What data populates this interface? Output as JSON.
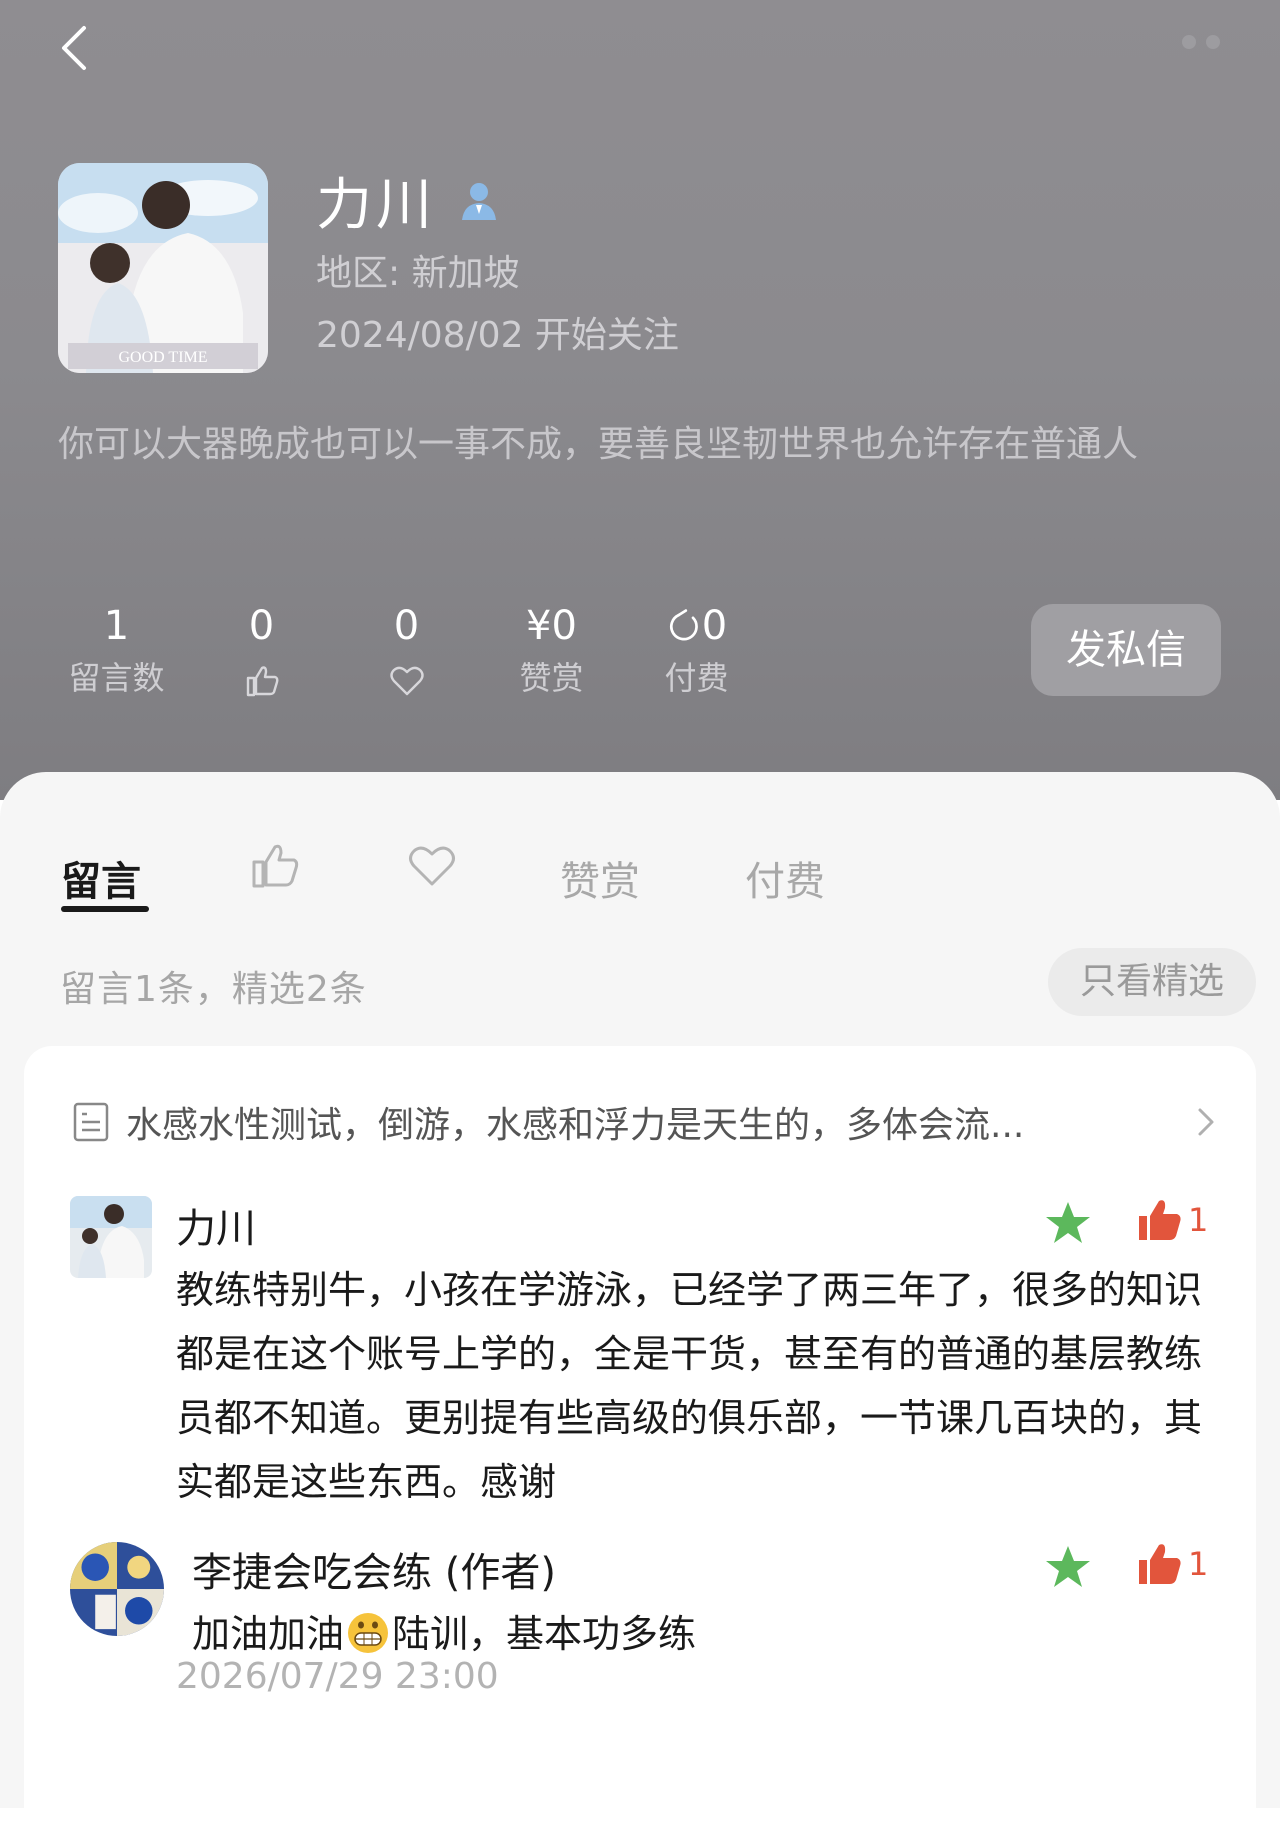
{
  "profile": {
    "name": "力川",
    "region": "地区: 新加坡",
    "follow_date": "2024/08/02 开始关注",
    "bio": "你可以大器晚成也可以一事不成，要善良坚韧世界也允许存在普通人",
    "avatar_caption": "GOOD TIME"
  },
  "stats": {
    "comments": {
      "value": "1",
      "label": "留言数"
    },
    "likes": {
      "value": "0",
      "icon": "thumbs-up-icon"
    },
    "favorites": {
      "value": "0",
      "icon": "heart-icon"
    },
    "rewards": {
      "value": "¥0",
      "label": "赞赏"
    },
    "paid": {
      "value": "0",
      "label": "付费"
    }
  },
  "dm_button": "发私信",
  "tabs": {
    "comments": "留言",
    "likes_icon": "thumbs-up-icon",
    "favorites_icon": "heart-icon",
    "rewards": "赞赏",
    "paid": "付费"
  },
  "summary": "留言1条，精选2条",
  "filter_button": "只看精选",
  "article": {
    "title": "水感水性测试，倒游，水感和浮力是天生的，多体会流..."
  },
  "comments": [
    {
      "author": "力川",
      "text": "教练特别牛，小孩在学游泳，已经学了两三年了，很多的知识都是在这个账号上学的，全是干货，甚至有的普通的基层教练员都不知道。更别提有些高级的俱乐部，一节课几百块的，其实都是这些东西。感谢",
      "likes": "1"
    },
    {
      "author": "李捷会吃会练 (作者)",
      "text_before": "加油加油",
      "text_after": "陆训，基本功多练",
      "likes": "1"
    }
  ],
  "timestamp": "2026/07/29 23:00",
  "colors": {
    "header_bg": "#8b8a8e",
    "like_red": "#e2553c",
    "star_green": "#5cb85c"
  }
}
